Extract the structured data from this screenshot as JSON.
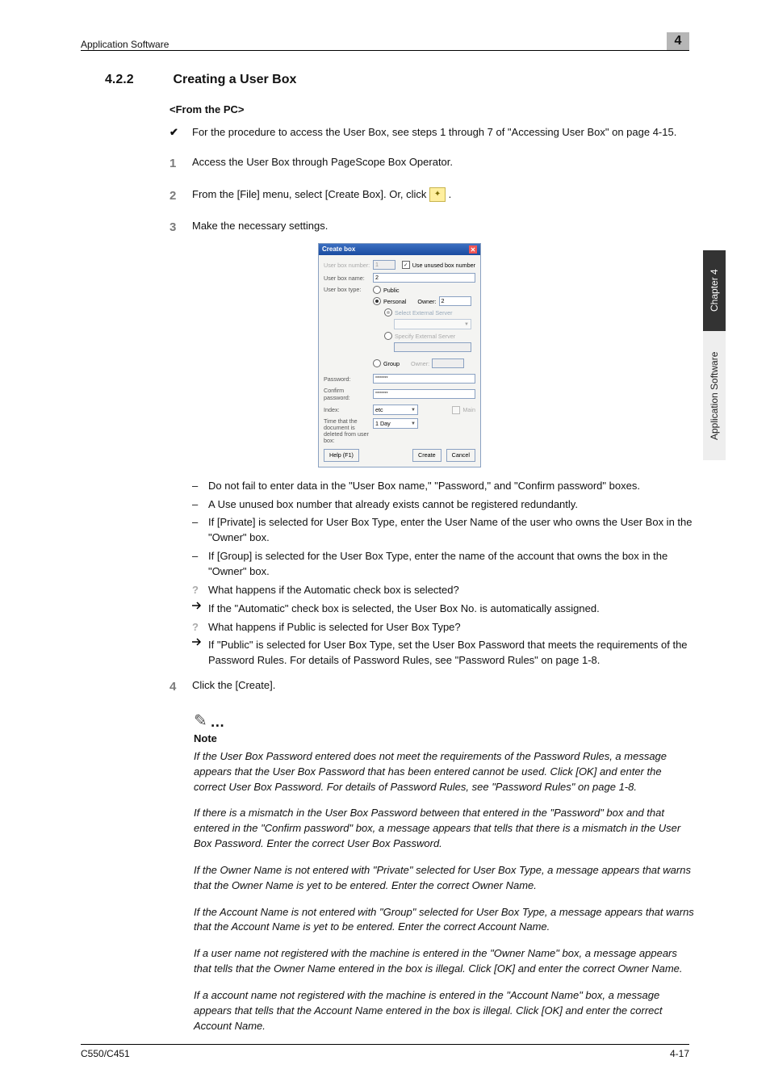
{
  "header": {
    "breadcrumb": "Application Software",
    "chapter_num": "4"
  },
  "side": {
    "dark": "Chapter 4",
    "light": "Application Software"
  },
  "title": {
    "num": "4.2.2",
    "text": "Creating a User Box"
  },
  "subheading": "<From the PC>",
  "check1": "For the procedure to access the User Box, see steps 1 through 7 of \"Accessing User Box\" on page 4-15.",
  "steps": {
    "s1": {
      "n": "1",
      "t": "Access the User Box through PageScope Box Operator."
    },
    "s2": {
      "n": "2",
      "t_a": "From the [File] menu, select [Create Box]. Or, click ",
      "t_b": "."
    },
    "s3": {
      "n": "3",
      "t": "Make the necessary settings."
    },
    "s4": {
      "n": "4",
      "t": "Click the [Create]."
    }
  },
  "dashes": {
    "d1": "Do not fail to enter data in the \"User Box name,\" \"Password,\" and \"Confirm password\" boxes.",
    "d2": "A Use unused box number that already exists cannot be registered redundantly.",
    "d3": "If [Private] is selected for User Box Type, enter the User Name of the user who owns the User Box in the \"Owner\" box.",
    "d4": "If [Group] is selected for the User Box Type, enter the name of the account that owns the box in the \"Owner\" box."
  },
  "qa": {
    "q1": "What happens if the Automatic check box is selected?",
    "a1": "If the \"Automatic\" check box is selected, the User Box No. is automatically assigned.",
    "q2": "What happens if Public is selected for User Box Type?",
    "a2": "If \"Public\" is selected for User Box Type, set the User Box Password that meets the requirements of the Password Rules. For details of Password Rules, see \"Password Rules\" on page 1-8."
  },
  "note": {
    "heading": "Note",
    "p1": "If the User Box Password entered does not meet the requirements of the Password Rules, a message appears that the User Box Password that has been entered cannot be used. Click [OK] and enter the correct User Box Password. For details of Password Rules, see \"Password Rules\" on page 1-8.",
    "p2": "If there is a mismatch in the User Box Password between that entered in the \"Password\" box and that entered in the \"Confirm password\" box, a message appears that tells that there is a mismatch in the User Box Password. Enter the correct User Box Password.",
    "p3": "If the Owner Name is not entered with \"Private\" selected for User Box Type, a message appears that warns that the Owner Name is yet to be entered. Enter the correct Owner Name.",
    "p4": "If the Account Name is not entered with \"Group\" selected for User Box Type, a message appears that warns that the Account Name is yet to be entered. Enter the correct Account Name.",
    "p5": "If a user name not registered with the machine is entered in the \"Owner Name\" box, a message appears that tells that the Owner Name entered in the box is illegal. Click [OK] and enter the correct Owner Name.",
    "p6": "If a account name not registered with the machine is entered in the \"Account Name\" box, a message appears that tells that the Account Name entered in the box is illegal. Click [OK] and enter the correct Account Name."
  },
  "dialog": {
    "title": "Create box",
    "user_box_number": "User box number:",
    "number_value": "1",
    "use_unused": "Use unused box number",
    "user_box_name": "User box name:",
    "name_value": "2",
    "user_box_type": "User box type:",
    "public": "Public",
    "personal": "Personal",
    "owner_label": "Owner:",
    "owner_value": "2",
    "select_ext": "Select External Server",
    "specify_ext": "Specify External Server",
    "group": "Group",
    "group_owner_label": "Owner:",
    "password": "Password:",
    "pw_value": "********",
    "confirm_password": "Confirm password:",
    "cpw_value": "********",
    "index": "Index:",
    "index_value": "etc",
    "main_chk": "Main",
    "time_label": "Time that the document is deleted from user box:",
    "time_value": "1 Day",
    "help_btn": "Help (F1)",
    "create_btn": "Create",
    "cancel_btn": "Cancel"
  },
  "footer": {
    "model": "C550/C451",
    "page": "4-17"
  }
}
